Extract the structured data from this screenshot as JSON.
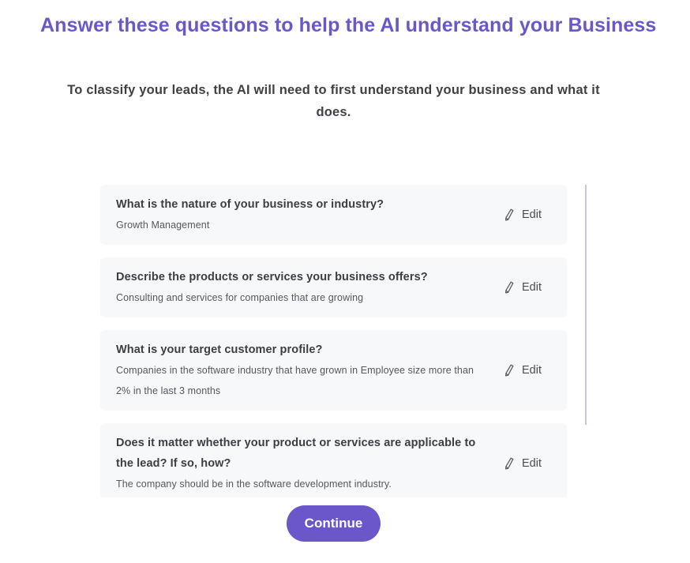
{
  "header": {
    "title": "Answer these questions to help the AI understand your Business",
    "subtitle": "To classify your leads, the AI will need to first understand your business and what it does."
  },
  "questions": [
    {
      "question": "What is the nature of your business or industry?",
      "answer": "Growth Management",
      "edit_label": "Edit"
    },
    {
      "question": "Describe the products or services your business offers?",
      "answer": "Consulting and services for companies that are growing",
      "edit_label": "Edit"
    },
    {
      "question": "What is your target customer profile?",
      "answer": "Companies in the software industry that have grown in Employee size more than 2% in the last 3 months",
      "edit_label": "Edit"
    },
    {
      "question": "Does it matter whether your product or services are applicable to the lead? If so, how?",
      "answer": "The company should be in the software development industry.",
      "edit_label": "Edit"
    }
  ],
  "icons": {
    "edit": "pencil-icon"
  },
  "actions": {
    "continue_label": "Continue"
  },
  "colors": {
    "accent": "#6b57c9",
    "card_background": "#f7f8fa",
    "scrollbar": "#c9c4ea"
  }
}
